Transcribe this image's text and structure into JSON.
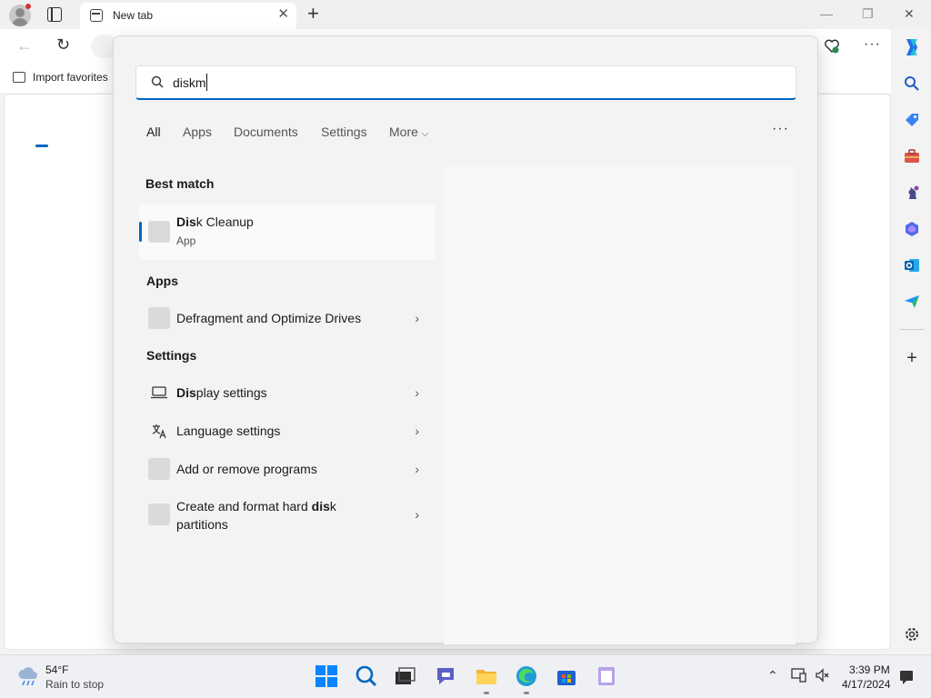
{
  "browser": {
    "tab_title": "New tab",
    "favorites_label": "Import favorites"
  },
  "search": {
    "query": "diskm",
    "filters": [
      "All",
      "Apps",
      "Documents",
      "Settings",
      "More"
    ],
    "best_match_header": "Best match",
    "best_match": {
      "name_bold": "Dis",
      "name_rest": "k Cleanup",
      "type": "App"
    },
    "apps_header": "Apps",
    "apps": [
      {
        "label": "Defragment and Optimize Drives"
      }
    ],
    "settings_header": "Settings",
    "settings": [
      {
        "bold": "Dis",
        "rest": "play settings"
      },
      {
        "bold": "",
        "rest": "Language settings"
      },
      {
        "bold": "",
        "rest": "Add or remove programs"
      },
      {
        "pre": "Create and format hard ",
        "bold": "dis",
        "post": "k",
        "line2": "partitions"
      }
    ]
  },
  "taskbar": {
    "weather_temp": "54°F",
    "weather_desc": "Rain to stop",
    "time": "3:39 PM",
    "date": "4/17/2024"
  },
  "colors": {
    "accent": "#0067c0",
    "flyout_bg": "#f3f3f3"
  }
}
